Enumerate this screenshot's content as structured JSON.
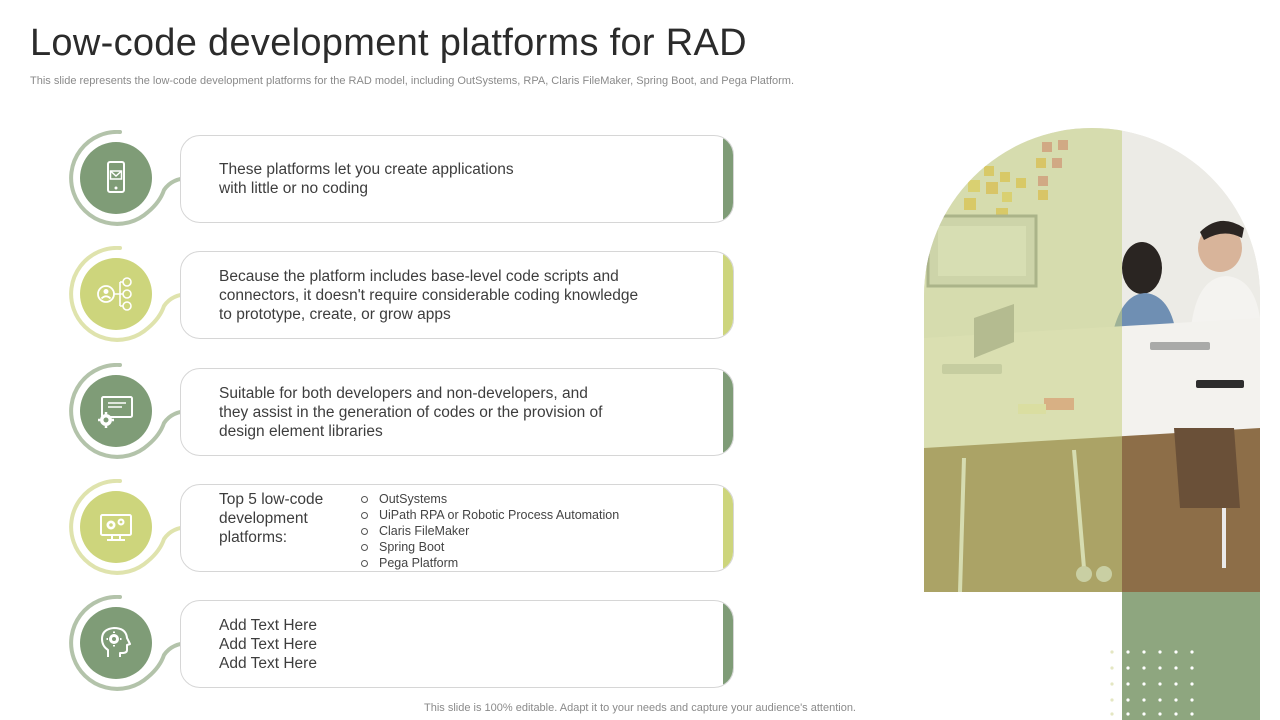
{
  "title": "Low-code development platforms for RAD",
  "subtitle": "This slide represents the low-code development platforms for the RAD  model, including OutSystems, RPA, Claris FileMaker, Spring Boot, and Pega Platform.",
  "colors": {
    "sage_green": "#7f9c77",
    "lime_green": "#cdd57c",
    "block_green": "#8ea67f"
  },
  "rows": [
    {
      "icon": "mobile-mail-icon",
      "text": "These platforms let you create applications\nwith little or no coding"
    },
    {
      "icon": "user-network-icon",
      "text": "Because the platform includes base-level code scripts and\nconnectors,  it doesn't require considerable coding knowledge\nto prototype,  create,  or grow apps"
    },
    {
      "icon": "monitor-gear-icon",
      "text": "Suitable for both developers and non-developers,  and\nthey assist in the generation of codes or the provision of\ndesign element libraries"
    },
    {
      "icon": "monitor-gears-icon",
      "heading": "Top 5 low-code\ndevelopment\nplatforms:",
      "bullets": [
        "OutSystems",
        "UiPath RPA or Robotic Process Automation",
        "Claris FileMaker",
        "Spring Boot",
        "Pega Platform"
      ]
    },
    {
      "icon": "head-gear-icon",
      "text": "Add Text Here\nAdd Text Here\nAdd Text Here"
    }
  ],
  "footer": "This slide is 100% editable. Adapt it to your needs and capture your audience's attention."
}
